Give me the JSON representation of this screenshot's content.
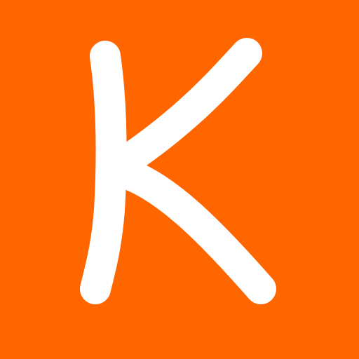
{
  "logo": {
    "letter": "K",
    "background_color": "#ff6600",
    "letter_color": "#ffffff"
  }
}
